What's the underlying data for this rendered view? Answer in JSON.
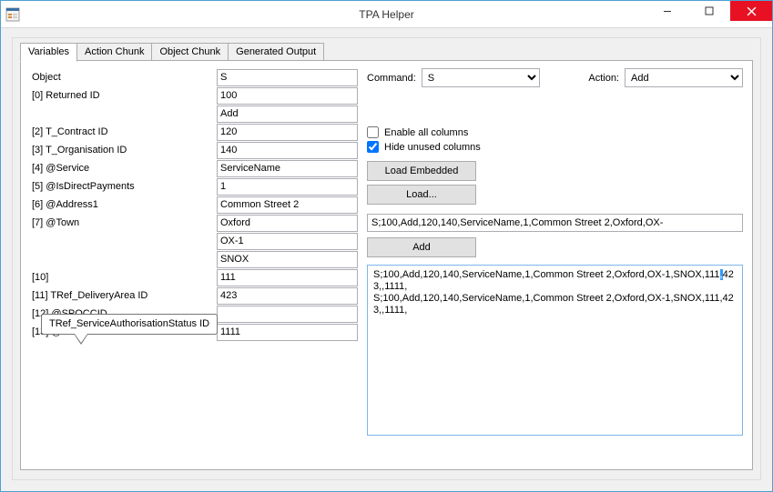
{
  "window": {
    "title": "TPA Helper"
  },
  "tabs": [
    {
      "label": "Variables"
    },
    {
      "label": "Action Chunk"
    },
    {
      "label": "Object Chunk"
    },
    {
      "label": "Generated Output"
    }
  ],
  "left_rows": [
    {
      "label": "Object",
      "value": "S"
    },
    {
      "label": "[0] Returned ID",
      "value": "100"
    },
    {
      "label": "",
      "value": "Add"
    },
    {
      "label": "[2] T_Contract ID",
      "value": "120"
    },
    {
      "label": "[3] T_Organisation ID",
      "value": "140"
    },
    {
      "label": "[4] @Service",
      "value": "ServiceName"
    },
    {
      "label": "[5] @IsDirectPayments",
      "value": "1"
    },
    {
      "label": "[6] @Address1",
      "value": "Common Street 2"
    },
    {
      "label": "[7] @Town",
      "value": "Oxford"
    },
    {
      "label": "",
      "value": "OX-1"
    },
    {
      "label": "",
      "value": "SNOX"
    },
    {
      "label": "[10]",
      "value": "111"
    },
    {
      "label": "[11] TRef_DeliveryArea ID",
      "value": "423"
    },
    {
      "label": "[12] @SPOCCID",
      "value": ""
    },
    {
      "label": "[13] @SiteID",
      "value": "1111"
    }
  ],
  "tooltip_text": "TRef_ServiceAuthorisationStatus ID",
  "right": {
    "cmd_label": "Command:",
    "cmd_value": "S",
    "act_label": "Action:",
    "act_value": "Add",
    "chk1": "Enable all columns",
    "chk2": "Hide unused columns",
    "btn_load_emb": "Load Embedded",
    "btn_load": "Load...",
    "input_line": "S;100,Add,120,140,ServiceName,1,Common Street 2,Oxford,OX-",
    "btn_add": "Add",
    "output_line1a": "S;100,Add,120,140,ServiceName,1,Common Street 2,Oxford,OX-1,SNOX,111",
    "output_line1_sel": ",",
    "output_line1b": "423,,1111,",
    "output_line2": "S;100,Add,120,140,ServiceName,1,Common Street 2,Oxford,OX-1,SNOX,111,423,,1111,"
  }
}
